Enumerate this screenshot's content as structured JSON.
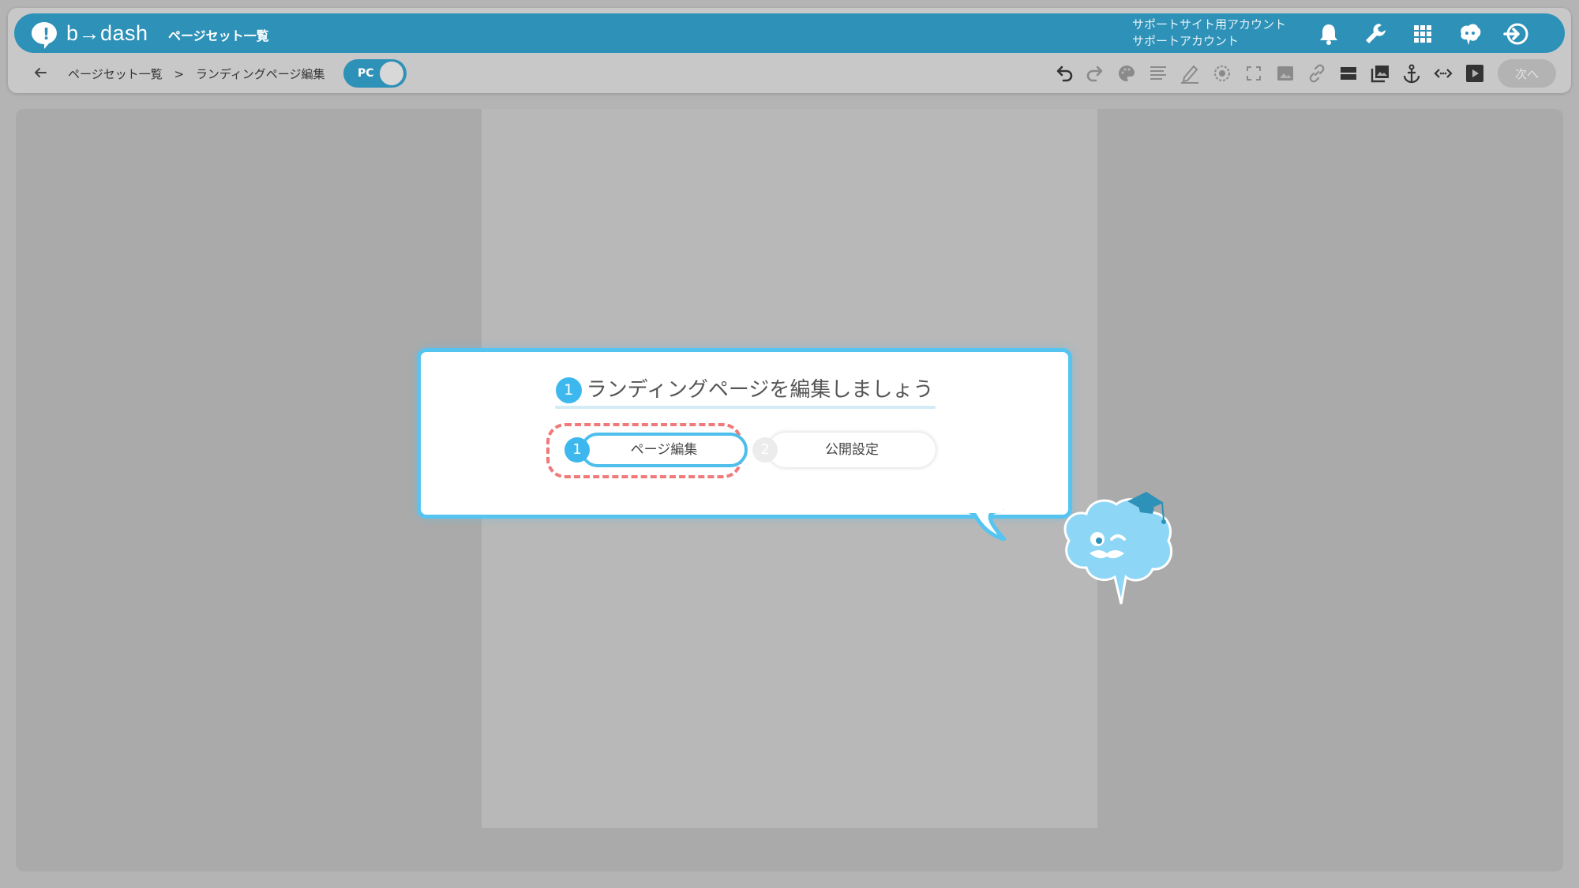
{
  "app": {
    "logo_text": "b→dash",
    "topbar_title": "ページセット一覧"
  },
  "account": {
    "line1": "サポートサイト用アカウント",
    "line2": "サポートアカウント"
  },
  "topbar_icons": [
    "bell-icon",
    "wrench-icon",
    "apps-grid-icon",
    "mascot-icon",
    "logout-icon"
  ],
  "breadcrumb": {
    "items": [
      "ページセット一覧",
      ">",
      "ランディングページ編集"
    ]
  },
  "device_toggle": {
    "label": "PC",
    "on": true
  },
  "toolbar_icons": [
    "undo-icon",
    "redo-icon",
    "palette-icon",
    "text-align-icon",
    "pen-icon",
    "target-icon",
    "fullscreen-icon",
    "image-icon",
    "link-icon",
    "section-icon",
    "gallery-icon",
    "anchor-icon",
    "code-icon",
    "video-icon"
  ],
  "next_button": {
    "label": "次へ",
    "enabled": false
  },
  "tutorial": {
    "title_number": "1",
    "title": "ランディングページを編集しましょう",
    "steps": [
      {
        "number": "1",
        "label": "ページ編集",
        "active": true
      },
      {
        "number": "2",
        "label": "公開設定",
        "active": false
      }
    ]
  },
  "colors": {
    "brand": "#2e91b8",
    "highlight": "#55c4f0",
    "dashed": "#f07a7a"
  }
}
